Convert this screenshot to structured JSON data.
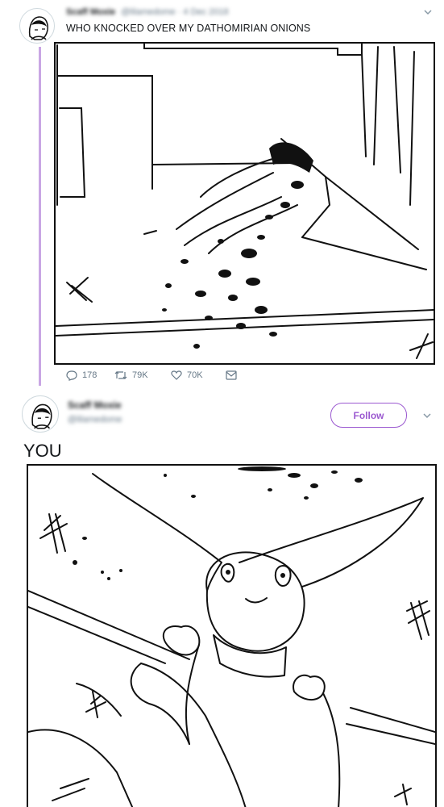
{
  "tweet1": {
    "display_name": "Scaff Moxie",
    "handle_time": "@lilamedome · 4 Dec 2018",
    "text": "WHO KNOCKED OVER MY DATHOMIRIAN ONIONS",
    "image_alt": "sketch of a spilled onion bin",
    "actions": {
      "replies": "178",
      "retweets": "79K",
      "likes": "70K"
    }
  },
  "tweet2": {
    "display_name": "Scaff Moxie",
    "handle": "@lilamedome",
    "follow_label": "Follow",
    "text": "YOU",
    "image_alt": "sketch of a big-eared creature wearing a scarf"
  },
  "icons": {
    "menu": "chevron-down-icon",
    "reply": "reply-icon",
    "retweet": "retweet-icon",
    "like": "heart-icon",
    "dm": "envelope-icon"
  },
  "colors": {
    "accent": "#9b59d0",
    "thread_line": "#c9a6e4",
    "muted": "#657786"
  }
}
